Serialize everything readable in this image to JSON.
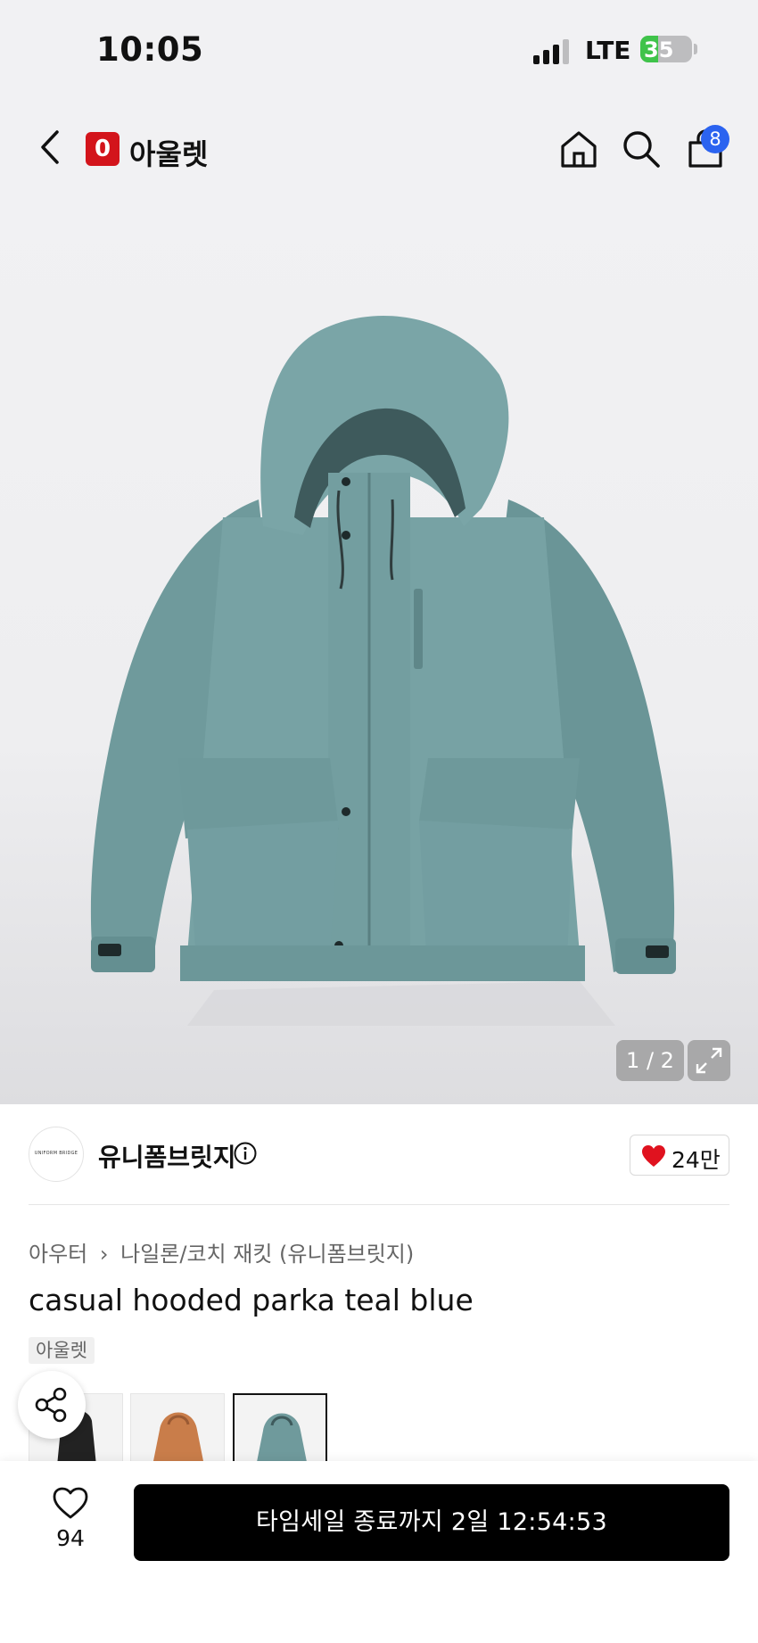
{
  "status_bar": {
    "time": "10:05",
    "network": "LTE",
    "battery_level": "35",
    "battery_fill_percent": 35,
    "battery_color": "#3fc34a"
  },
  "nav": {
    "logo_letter": "0",
    "brand_title": "아울렛",
    "cart_count": "8",
    "icons": [
      "back-icon",
      "home-icon",
      "search-icon",
      "cart-icon"
    ],
    "logo_color": "#d3141b",
    "badge_color": "#2b63f0"
  },
  "gallery": {
    "page_indicator": "1 / 2",
    "product_color": "#6f9a9c"
  },
  "brand": {
    "avatar_text": "UNIFORM BRIDGE",
    "name": "유니폼브릿지",
    "likes": "24만",
    "heart_color": "#e0121f"
  },
  "product": {
    "breadcrumb": [
      "아우터",
      "나일론/코치 재킷 (유니폼브릿지)"
    ],
    "title": "casual hooded parka teal blue",
    "tag": "아울렛"
  },
  "color_options": [
    {
      "color": "#222222"
    },
    {
      "color": "#c97d4a"
    },
    {
      "color": "#6f9a9c",
      "selected": true
    }
  ],
  "bottom": {
    "wish_count": "94",
    "buy_label": "타임세일 종료까지 2일 12:54:53"
  }
}
